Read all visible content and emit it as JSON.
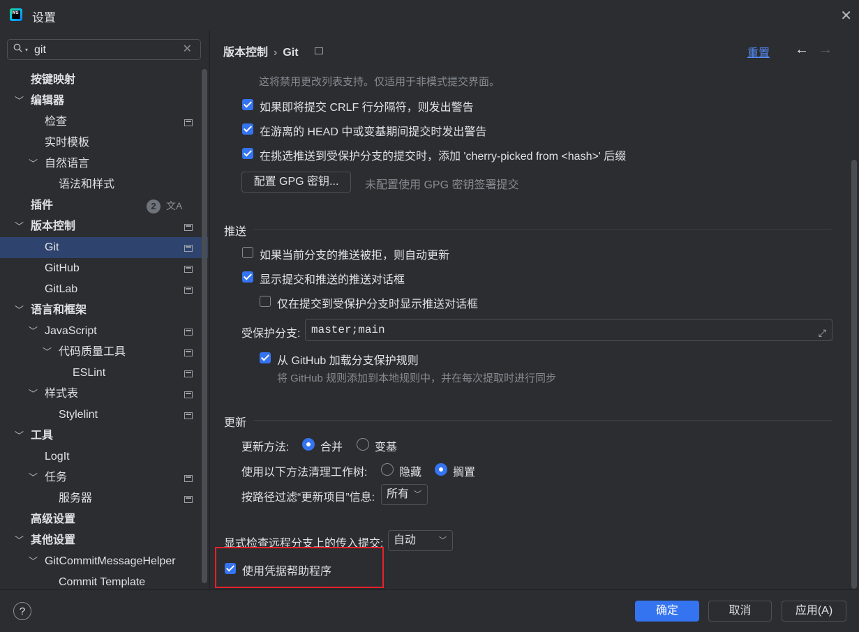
{
  "window": {
    "title": "设置"
  },
  "search": {
    "value": "git"
  },
  "tree": [
    {
      "label": "按键映射",
      "bold": true
    },
    {
      "label": "编辑器",
      "bold": true,
      "arrow": "expanded"
    },
    {
      "label": "检查",
      "pin": true
    },
    {
      "label": "实时模板"
    },
    {
      "label": "自然语言",
      "arrow": "expanded"
    },
    {
      "label": "语法和样式"
    },
    {
      "label": "插件",
      "bold": true,
      "badge": "2"
    },
    {
      "label": "版本控制",
      "bold": true,
      "arrow": "expanded",
      "pin": true
    },
    {
      "label": "Git",
      "pin": true,
      "selected": true
    },
    {
      "label": "GitHub",
      "pin": true
    },
    {
      "label": "GitLab",
      "pin": true
    },
    {
      "label": "语言和框架",
      "bold": true,
      "arrow": "expanded"
    },
    {
      "label": "JavaScript",
      "arrow": "expanded",
      "pin": true
    },
    {
      "label": "代码质量工具",
      "arrow": "expanded",
      "pin": true
    },
    {
      "label": "ESLint",
      "pin": true
    },
    {
      "label": "样式表",
      "arrow": "expanded",
      "pin": true
    },
    {
      "label": "Stylelint",
      "pin": true
    },
    {
      "label": "工具",
      "bold": true,
      "arrow": "expanded"
    },
    {
      "label": "LogIt"
    },
    {
      "label": "任务",
      "arrow": "expanded",
      "pin": true
    },
    {
      "label": "服务器",
      "pin": true
    },
    {
      "label": "高级设置",
      "bold": true
    },
    {
      "label": "其他设置",
      "bold": true,
      "arrow": "expanded"
    },
    {
      "label": "GitCommitMessageHelper",
      "arrow": "expanded"
    },
    {
      "label": "Commit Template"
    }
  ],
  "header": {
    "breadcrumb_parent": "版本控制",
    "breadcrumb_sep": "›",
    "breadcrumb_current": "Git",
    "reset": "重置"
  },
  "content": {
    "top_hint": "这将禁用更改列表支持。仅适用于非模式提交界面。",
    "crlf_warning": "如果即将提交 CRLF 行分隔符，则发出警告",
    "detached_head_warning": "在游离的 HEAD 中或变基期间提交时发出警告",
    "cherry_pick_suffix": "在挑选推送到受保护分支的提交时，添加 'cherry-picked from <hash>' 后缀",
    "gpg_button": "配置 GPG 密钥...",
    "gpg_hint": "未配置使用 GPG 密钥签署提交",
    "push": {
      "title": "推送",
      "auto_update": "如果当前分支的推送被拒，则自动更新",
      "show_dialog": "显示提交和推送的推送对话框",
      "only_protected": "仅在提交到受保护分支时显示推送对话框",
      "protected_label": "受保护分支:",
      "protected_value": "master;main",
      "load_github_rules": "从 GitHub 加载分支保护规则",
      "github_rules_hint": "将 GitHub 规则添加到本地规则中，并在每次提取时进行同步"
    },
    "update": {
      "title": "更新",
      "method_label": "更新方法:",
      "method_merge": "合并",
      "method_rebase": "变基",
      "clean_label": "使用以下方法清理工作树:",
      "clean_stash": "隐藏",
      "clean_shelve": "搁置",
      "filter_label": "按路径过滤“更新项目”信息:",
      "filter_value": "所有"
    },
    "incoming_label": "显式检查远程分支上的传入提交:",
    "incoming_value": "自动",
    "credential_helper": "使用凭据帮助程序"
  },
  "checks": {
    "crlf_warning": true,
    "detached_head_warning": true,
    "cherry_pick_suffix": true,
    "auto_update": false,
    "show_dialog": true,
    "only_protected": false,
    "load_github_rules": true,
    "credential_helper": true
  },
  "radios": {
    "update_method": "merge",
    "clean_method": "shelve"
  },
  "footer": {
    "ok": "确定",
    "cancel": "取消",
    "apply": "应用(A)",
    "help": "?"
  },
  "colors": {
    "accent": "#3574f0",
    "link": "#548af7",
    "highlight": "#e5212b",
    "selection": "#2e436e"
  }
}
